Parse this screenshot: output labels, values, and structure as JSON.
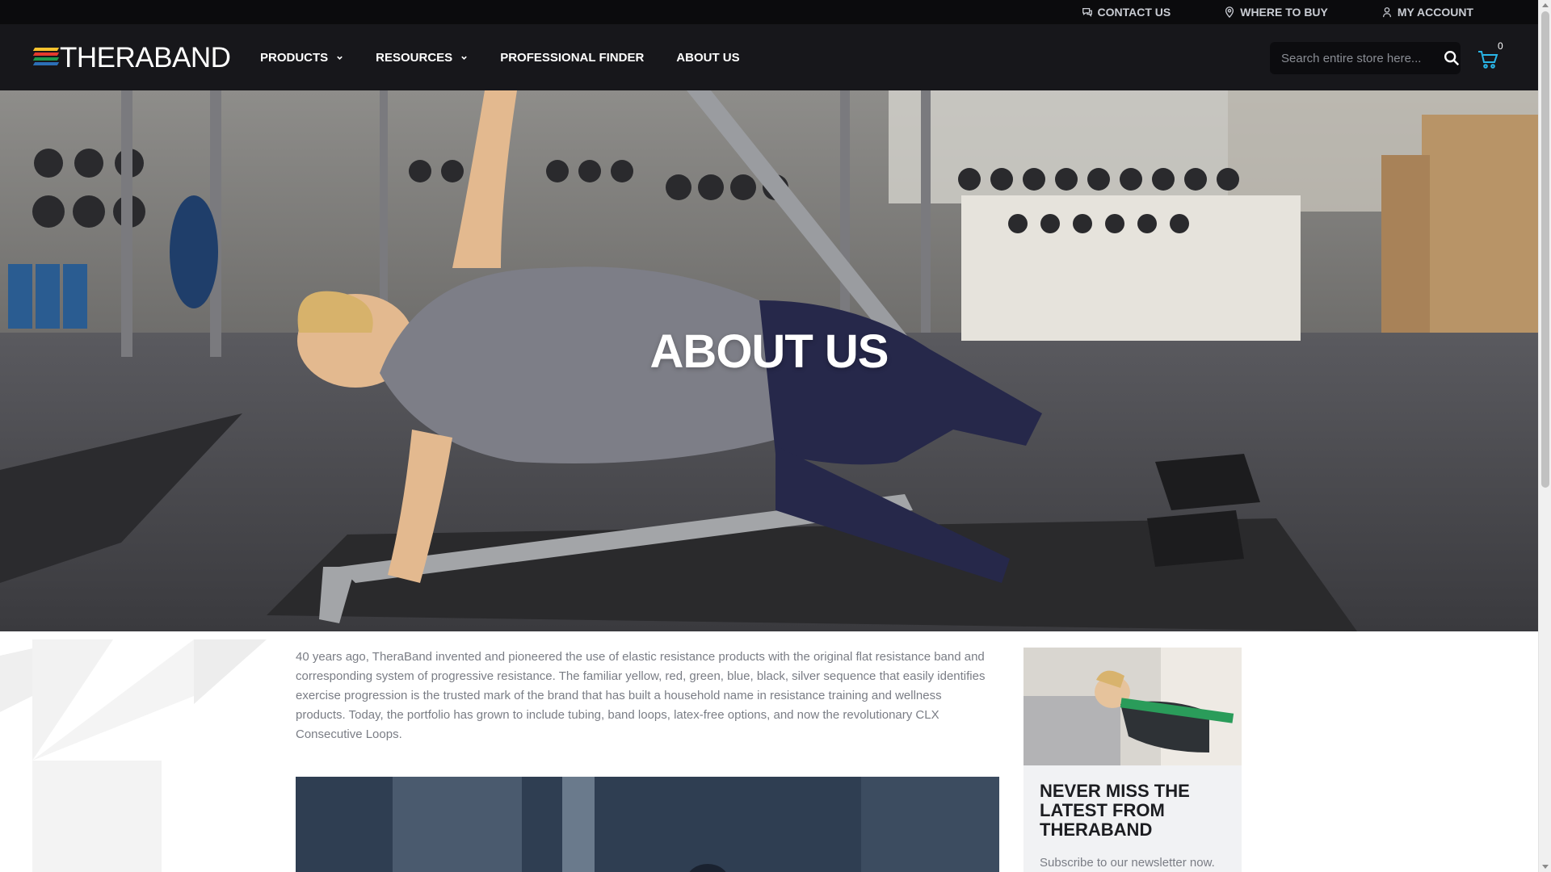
{
  "utility": {
    "links": [
      {
        "label": "CONTACT US",
        "icon": "chat-icon"
      },
      {
        "label": "WHERE TO BUY",
        "icon": "map-pin-icon"
      },
      {
        "label": "MY ACCOUNT",
        "icon": "user-icon"
      }
    ]
  },
  "header": {
    "logo": {
      "prefix": "THERA",
      "suffix": "BAND",
      "stripes": [
        "#f6c22e",
        "#e43a2e",
        "#1f9a4b",
        "#2c6fb7"
      ]
    },
    "nav": [
      {
        "label": "PRODUCTS",
        "has_dropdown": true
      },
      {
        "label": "RESOURCES",
        "has_dropdown": true
      },
      {
        "label": "PROFESSIONAL FINDER",
        "has_dropdown": false
      },
      {
        "label": "ABOUT US",
        "has_dropdown": false
      }
    ],
    "search": {
      "placeholder": "Search entire store here..."
    },
    "cart": {
      "count": "0",
      "accent": "#29b6e8"
    }
  },
  "hero": {
    "title": "ABOUT US"
  },
  "content": {
    "intro": "40 years ago, TheraBand invented and pioneered the use of elastic resistance products with the original flat resistance band and corresponding system of progressive resistance. The familiar yellow, red, green, blue, black, silver sequence that easily identifies exercise progression is the trusted mark of the brand that has built a household name in resistance training and wellness products. Today, the portfolio has grown to include tubing, band loops, latex-free options, and now the revolutionary CLX Consecutive Loops.",
    "sidebar": {
      "title": "NEVER MISS THE LATEST FROM THERABAND",
      "subtitle": "Subscribe to our newsletter now."
    }
  }
}
